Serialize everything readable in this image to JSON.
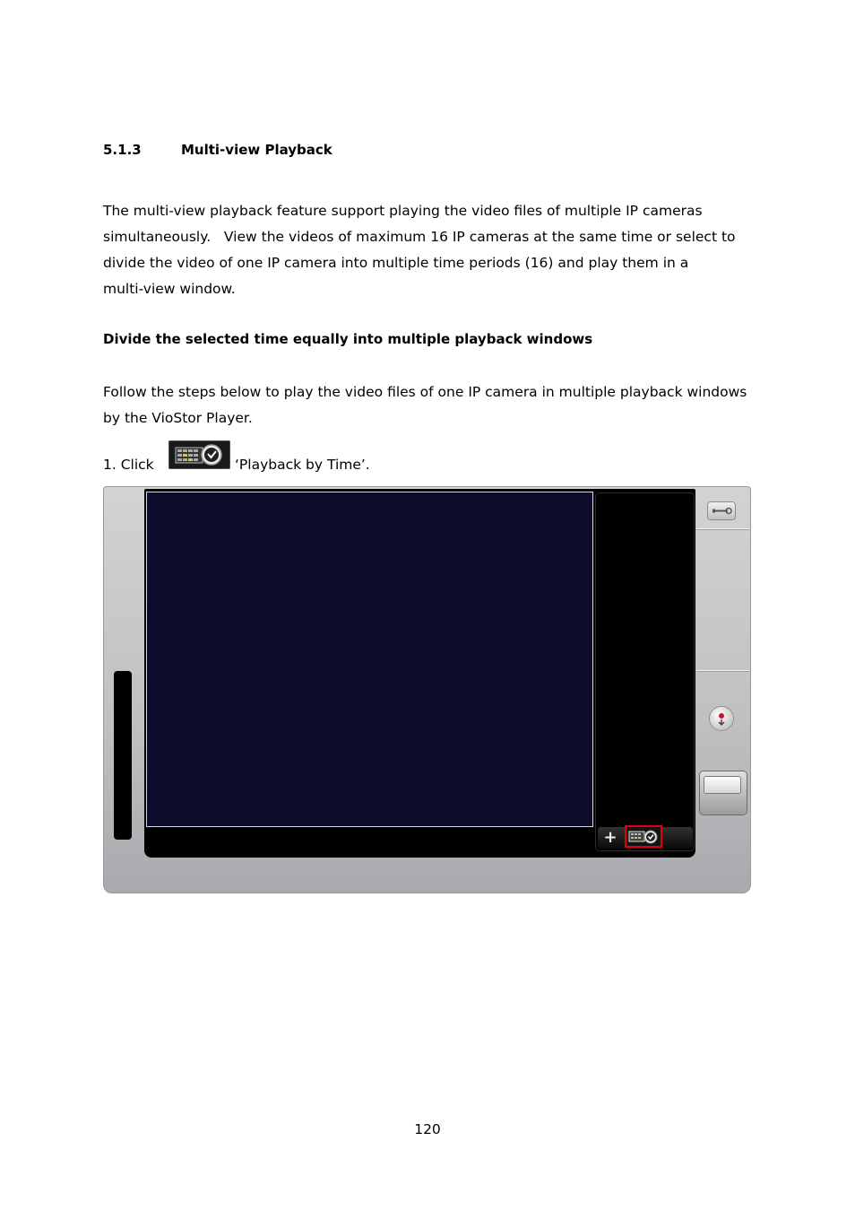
{
  "section": {
    "number": "5.1.3",
    "title": "Multi-view Playback"
  },
  "intro_lines": [
    "The multi-view playback feature support playing the video files of multiple IP cameras",
    "simultaneously.   View the videos of maximum 16 IP cameras at the same time or select to",
    "divide the video of one IP camera into multiple time periods (16) and play them in a",
    "multi-view window."
  ],
  "subheading": "Divide the selected time equally into multiple playback windows",
  "follow_text": "Follow the steps below to play the video files of one IP camera in multiple playback windows by the VioStor Player.",
  "step1": {
    "prefix": "1.  Click",
    "label": "‘Playback by Time’."
  },
  "player": {
    "plus_label": "+",
    "colors": {
      "video_bg": "#0b0d2b",
      "highlight": "#e00010"
    }
  },
  "page_number": "120"
}
